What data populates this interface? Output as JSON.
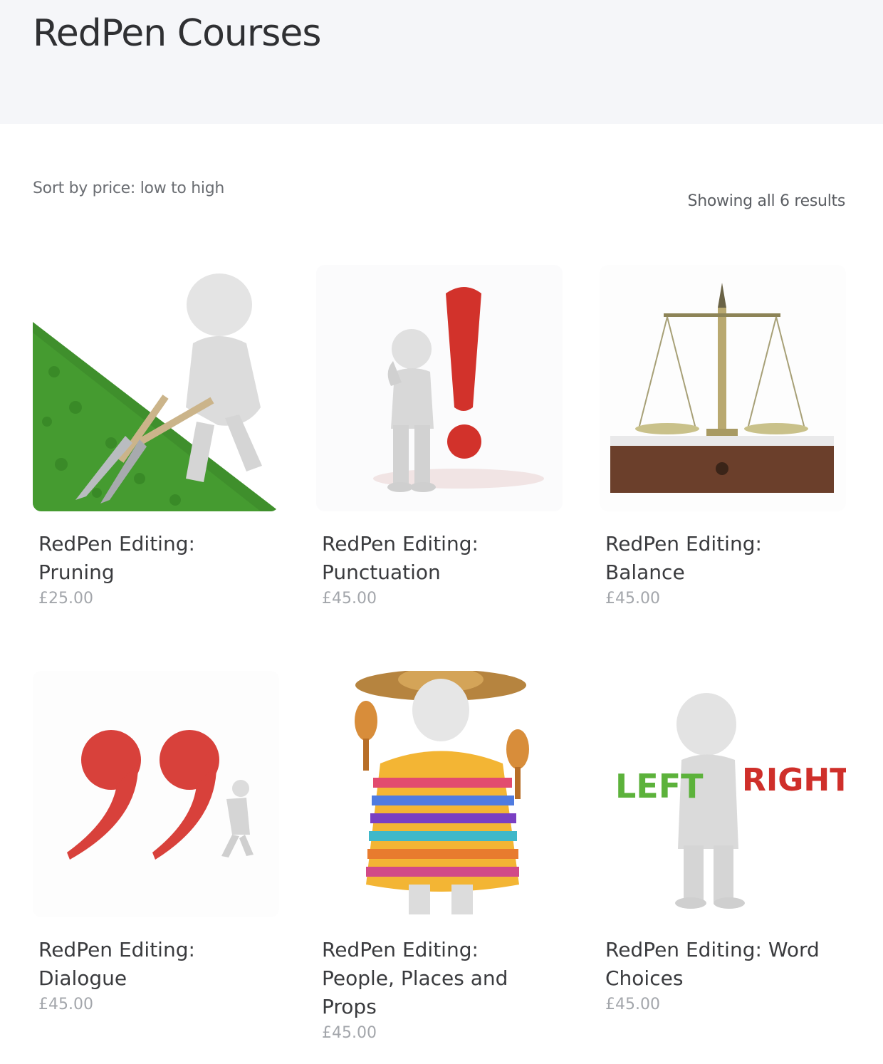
{
  "header": {
    "title": "RedPen Courses"
  },
  "toolbar": {
    "sort_label": "Sort by price: low to high",
    "result_count": "Showing all 6 results"
  },
  "products": [
    {
      "title": "RedPen Editing: Pruning",
      "price": "£25.00",
      "image_icon": "pruning-shears-figure-icon"
    },
    {
      "title": "RedPen Editing: Punctuation",
      "price": "£45.00",
      "image_icon": "exclamation-figure-icon"
    },
    {
      "title": "RedPen Editing: Balance",
      "price": "£45.00",
      "image_icon": "balance-scales-icon"
    },
    {
      "title": "RedPen Editing: Dialogue",
      "price": "£45.00",
      "image_icon": "quotation-marks-figure-icon"
    },
    {
      "title": "RedPen Editing: People, Places and Props",
      "price": "£45.00",
      "image_icon": "sombrero-poncho-figure-icon"
    },
    {
      "title": "RedPen Editing: Word Choices",
      "price": "£45.00",
      "image_icon": "left-right-words-figure-icon"
    }
  ],
  "image_text": {
    "left_word": "LEFT",
    "right_word": "RIGHT"
  },
  "colors": {
    "header_bg": "#f5f6f9",
    "accent_red": "#d23b32",
    "grass_green": "#3f8f2c",
    "price_gray": "#a3a6ab"
  }
}
